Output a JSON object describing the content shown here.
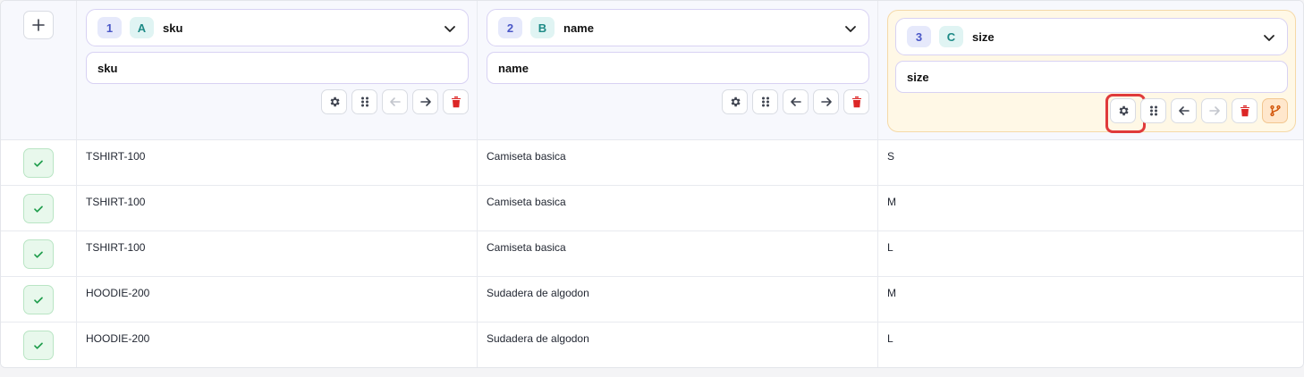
{
  "columns": [
    {
      "num": "1",
      "letter": "A",
      "title": "sku",
      "input_value": "sku"
    },
    {
      "num": "2",
      "letter": "B",
      "title": "name",
      "input_value": "name"
    },
    {
      "num": "3",
      "letter": "C",
      "title": "size",
      "input_value": "size"
    }
  ],
  "rows": [
    {
      "sku": "TSHIRT-100",
      "name": "Camiseta basica",
      "size": "S"
    },
    {
      "sku": "TSHIRT-100",
      "name": "Camiseta basica",
      "size": "M"
    },
    {
      "sku": "TSHIRT-100",
      "name": "Camiseta basica",
      "size": "L"
    },
    {
      "sku": "HOODIE-200",
      "name": "Sudadera de algodon",
      "size": "M"
    },
    {
      "sku": "HOODIE-200",
      "name": "Sudadera de algodon",
      "size": "L"
    }
  ],
  "colors": {
    "accent_border": "#d8d2f3",
    "highlight_bg": "#fff8e6",
    "delete_red": "#dc2626",
    "check_green": "#1f9d4c",
    "focus_ring": "#e03a3a"
  },
  "icons": {
    "add": "plus-icon",
    "dropdown": "chevron-down-icon",
    "settings": "gear-icon",
    "drag": "drag-handle-icon",
    "move_left": "arrow-left-icon",
    "move_right": "arrow-right-icon",
    "delete": "trash-icon",
    "split": "git-branch-icon",
    "row_ok": "check-icon"
  }
}
